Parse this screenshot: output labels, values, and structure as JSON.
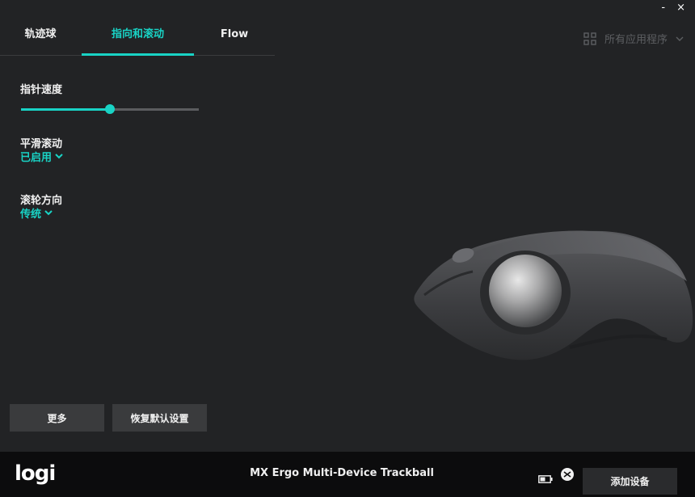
{
  "window": {
    "minimize_label": "-",
    "close_label": "×"
  },
  "tabs": [
    {
      "label": "轨迹球",
      "active": false
    },
    {
      "label": "指向和滚动",
      "active": true
    },
    {
      "label": "Flow",
      "active": false
    }
  ],
  "apps": {
    "icon": "grid-icon",
    "label": "所有应用程序"
  },
  "pointer_speed": {
    "label": "指针速度",
    "value_fraction": 0.5
  },
  "smooth_scrolling": {
    "label": "平滑滚动",
    "value": "已启用"
  },
  "scroll_direction": {
    "label": "滚轮方向",
    "value": "传统"
  },
  "buttons": {
    "more": "更多",
    "restore_defaults": "恢复默认设置"
  },
  "footer": {
    "logo": "logi",
    "device_name": "MX Ergo Multi-Device Trackball",
    "add_device": "添加设备"
  },
  "colors": {
    "accent": "#19d3c5",
    "background": "#222325",
    "footer": "#0c0c0d"
  }
}
